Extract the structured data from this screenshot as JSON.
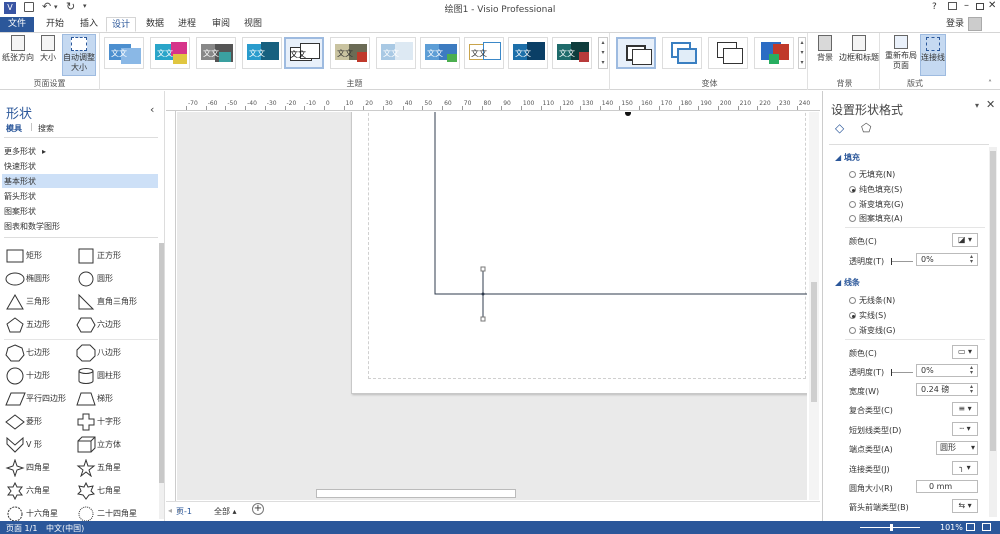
{
  "app": {
    "title": "绘图1 - Visio Professional",
    "login": "登录",
    "help": "?"
  },
  "file_tab": "文件",
  "tabs": [
    "开始",
    "插入",
    "设计",
    "数据",
    "进程",
    "审阅",
    "视图"
  ],
  "ribbon": {
    "page_setup": {
      "orientation": "纸张方向",
      "size": "大小",
      "auto_size": "自动调整大小",
      "label": "页面设置"
    },
    "themes_label": "主题",
    "theme_text": "文文",
    "variants_label": "变体",
    "background": {
      "bg": "背景",
      "borders": "边框和标题",
      "label": "背景"
    },
    "layout": {
      "relayout": "重新布局页面",
      "connector": "连接线",
      "label": "版式"
    }
  },
  "shapes_pane": {
    "title": "形状",
    "tabs": [
      "模具",
      "搜索"
    ],
    "collapse": "‹",
    "nav": [
      "更多形状",
      "快速形状",
      "基本形状",
      "箭头形状",
      "图案形状",
      "图表和数学图形"
    ],
    "shapes": [
      [
        "矩形",
        "正方形"
      ],
      [
        "椭圆形",
        "圆形"
      ],
      [
        "三角形",
        "直角三角形"
      ],
      [
        "五边形",
        "六边形"
      ],
      [
        "七边形",
        "八边形"
      ],
      [
        "十边形",
        "圆柱形"
      ],
      [
        "平行四边形",
        "梯形"
      ],
      [
        "菱形",
        "十字形"
      ],
      [
        "V 形",
        "立方体"
      ],
      [
        "四角星",
        "五角星"
      ],
      [
        "六角星",
        "七角星"
      ],
      [
        "十六角星",
        "二十四角星"
      ]
    ]
  },
  "ruler_labels": [
    "-70",
    "-60",
    "-50",
    "-40",
    "-30",
    "-20",
    "-10",
    "0",
    "10",
    "20",
    "30",
    "40",
    "50",
    "60",
    "70",
    "80",
    "90",
    "100",
    "110",
    "120",
    "130",
    "140",
    "150",
    "160",
    "170",
    "180",
    "190",
    "200",
    "210",
    "220",
    "230",
    "240",
    "250"
  ],
  "page_tabs": {
    "page1": "页-1",
    "all": "全部",
    "add": "+"
  },
  "format_pane": {
    "title": "设置形状格式",
    "fill_header": "填充",
    "fill_options": [
      "无填充(N)",
      "纯色填充(S)",
      "渐变填充(G)",
      "图案填充(A)"
    ],
    "fill_selected": 1,
    "color_label": "颜色(C)",
    "transparency_label": "透明度(T)",
    "transparency_value": "0%",
    "line_header": "线条",
    "line_options": [
      "无线条(N)",
      "实线(S)",
      "渐变线(G)"
    ],
    "line_selected": 1,
    "line_color_label": "颜色(C)",
    "line_transparency_label": "透明度(T)",
    "line_transparency_value": "0%",
    "width_label": "宽度(W)",
    "width_value": "0.24 磅",
    "compound_label": "复合类型(C)",
    "dash_label": "短划线类型(D)",
    "cap_label": "端点类型(A)",
    "cap_value": "圆形",
    "join_label": "连接类型(J)",
    "round_label": "圆角大小(R)",
    "round_value": "0 mm",
    "arrow_label": "箭头前端类型(B)"
  },
  "status": {
    "page": "页面 1/1",
    "lang": "中文(中国)",
    "zoom": "101%"
  },
  "colors": {
    "accent": "#2b579a",
    "file_tab": "#2b579a",
    "statusbar": "#2b579a",
    "selected_nav": "#cde0f7"
  }
}
